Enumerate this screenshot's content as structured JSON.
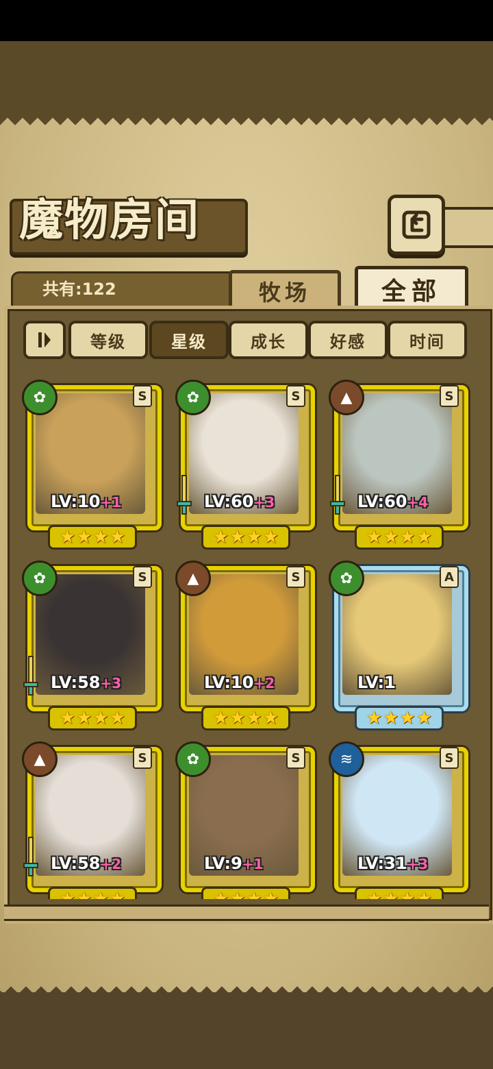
{
  "header": {
    "title": "魔物房间"
  },
  "counter": {
    "label": "共有:122"
  },
  "tabs": [
    {
      "label": "牧场",
      "active": false
    },
    {
      "label": "全部",
      "active": true
    }
  ],
  "sort": {
    "buttons": [
      {
        "label": "等级",
        "active": false
      },
      {
        "label": "星级",
        "active": true
      },
      {
        "label": "成长",
        "active": false
      },
      {
        "label": "好感",
        "active": false
      },
      {
        "label": "时间",
        "active": false
      }
    ]
  },
  "monsters": [
    {
      "level": "LV:10",
      "bonus": "+1",
      "rank": "S",
      "element": "leaf",
      "stars": 4,
      "has_weapon": false,
      "portrait_color": "#c9a15a"
    },
    {
      "level": "LV:60",
      "bonus": "+3",
      "rank": "S",
      "element": "leaf",
      "stars": 4,
      "has_weapon": true,
      "portrait_color": "#e9e2d6"
    },
    {
      "level": "LV:60",
      "bonus": "+4",
      "rank": "S",
      "element": "earth",
      "stars": 4,
      "has_weapon": true,
      "portrait_color": "#bcc6c0"
    },
    {
      "level": "LV:58",
      "bonus": "+3",
      "rank": "S",
      "element": "leaf",
      "stars": 4,
      "has_weapon": true,
      "portrait_color": "#3a3333"
    },
    {
      "level": "LV:10",
      "bonus": "+2",
      "rank": "S",
      "element": "earth",
      "stars": 4,
      "has_weapon": false,
      "portrait_color": "#d19b3a"
    },
    {
      "level": "LV:1",
      "bonus": "",
      "rank": "A",
      "element": "leaf",
      "stars": 4,
      "has_weapon": false,
      "portrait_color": "#e6c978",
      "frame": "blue"
    },
    {
      "level": "LV:58",
      "bonus": "+2",
      "rank": "S",
      "element": "earth",
      "stars": 4,
      "has_weapon": true,
      "portrait_color": "#e4ded7"
    },
    {
      "level": "LV:9",
      "bonus": "+1",
      "rank": "S",
      "element": "leaf",
      "stars": 4,
      "has_weapon": false,
      "portrait_color": "#8a6d4f"
    },
    {
      "level": "LV:31",
      "bonus": "+3",
      "rank": "S",
      "element": "water",
      "stars": 4,
      "has_weapon": false,
      "portrait_color": "#cfe6f5"
    }
  ],
  "colors": {
    "leaf_element": "#3d8f2e",
    "earth_element": "#7a4a2a",
    "water_element": "#1f5f9a",
    "gold_frame": "#e8d200",
    "blue_frame": "#a9dcf0",
    "bonus_text": "#ff5fa8"
  }
}
